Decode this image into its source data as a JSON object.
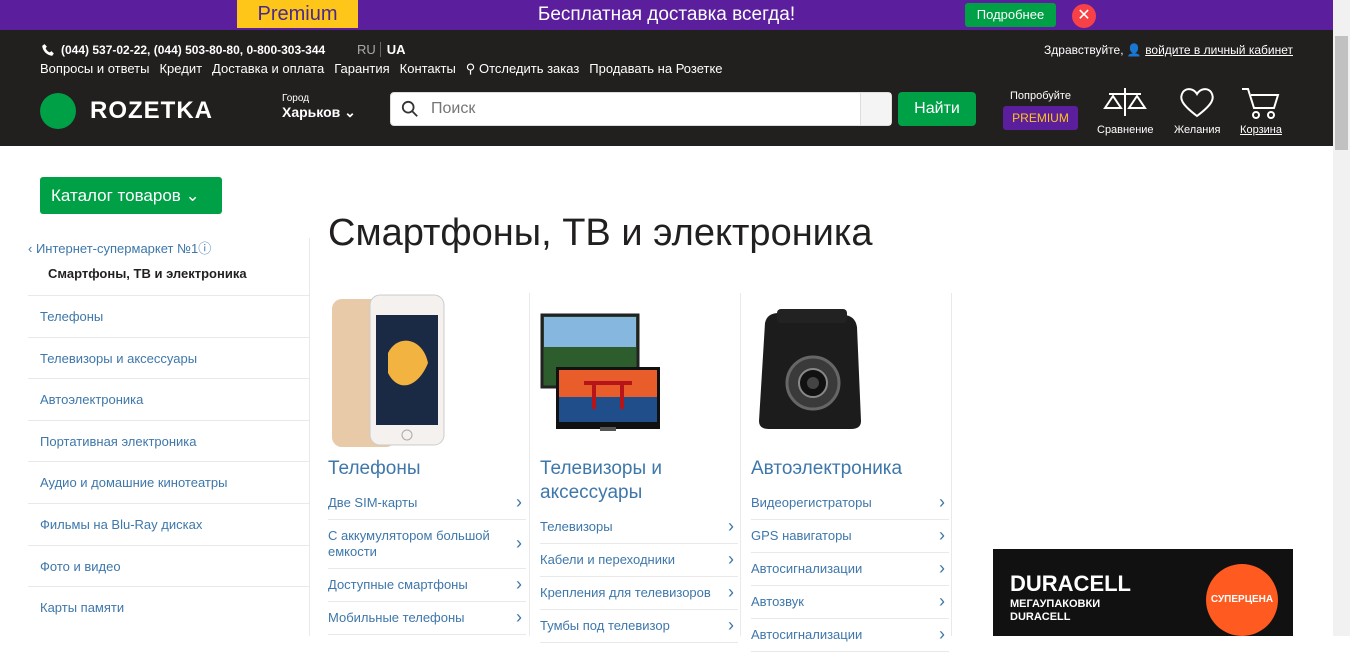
{
  "promo": {
    "badge": "Premium",
    "text": "Бесплатная доставка всегда!",
    "button": "Подробнее",
    "close": "✕"
  },
  "header": {
    "phones": "(044) 537-02-22, (044) 503-80-80, 0-800-303-344",
    "lang_ru": "RU",
    "lang_ua": "UA",
    "nav": [
      "Вопросы и ответы",
      "Кредит",
      "Доставка и оплата",
      "Гарантия",
      "Контакты",
      "Отследить заказ",
      "Продавать на Розетке"
    ],
    "greeting": "Здравствуйте,",
    "login": "войдите в личный кабинет",
    "logo": "ROZETKA",
    "city_label": "Город",
    "city": "Харьков",
    "search_placeholder": "Поиск",
    "find": "Найти",
    "premium_try": "Попробуйте",
    "premium": "PREMIUM",
    "compare": "Сравнение",
    "wishlist": "Желания",
    "cart": "Корзина"
  },
  "catalog_button": "Каталог товаров",
  "breadcrumb": {
    "parent": "Интернет-супермаркет №1",
    "current": "Смартфоны, ТВ и электроника"
  },
  "sidebar": [
    "Телефоны",
    "Телевизоры и аксессуары",
    "Автоэлектроника",
    "Портативная электроника",
    "Аудио и домашние кинотеатры",
    "Фильмы на Blu-Ray дисках",
    "Фото и видео",
    "Карты памяти"
  ],
  "page_title": "Смартфоны, ТВ и электроника",
  "categories": [
    {
      "title": "Телефоны",
      "items": [
        "Две SIM-карты",
        "С аккумулятором большой емкости",
        "Доступные смартфоны",
        "Мобильные телефоны"
      ]
    },
    {
      "title": "Телевизоры и аксессуары",
      "items": [
        "Телевизоры",
        "Кабели и переходники",
        "Крепления для телевизоров",
        "Тумбы под телевизор"
      ]
    },
    {
      "title": "Автоэлектроника",
      "items": [
        "Видеорегистраторы",
        "GPS навигаторы",
        "Автосигнализации",
        "Автозвук",
        "Автосигнализации"
      ]
    }
  ],
  "ad": {
    "brand": "DURACELL",
    "line1": "МЕГАУПАКОВКИ",
    "line2": "DURACELL",
    "badge": "СУПЕРЦЕНА"
  },
  "colors": {
    "accent": "#00a046",
    "header": "#221f1f",
    "promo": "#5b1e9c",
    "link": "#3e77aa"
  }
}
